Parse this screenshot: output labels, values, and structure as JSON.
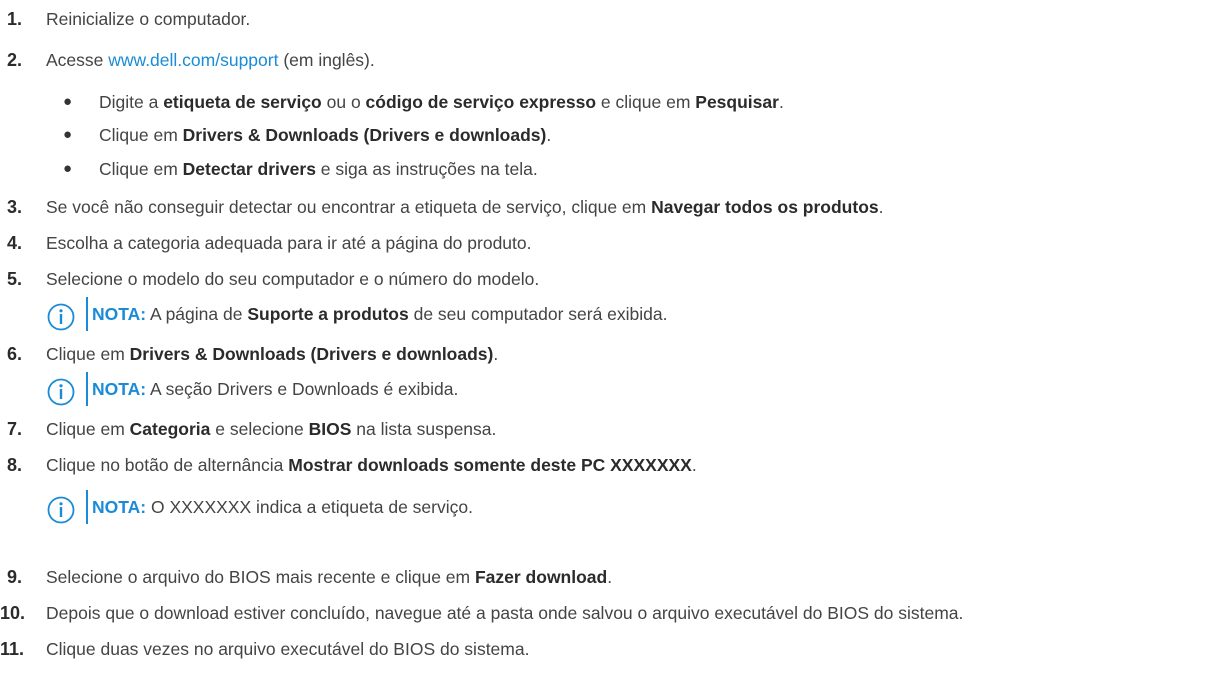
{
  "steps": [
    {
      "n": "1.",
      "parts": [
        {
          "t": "Reinicialize o computador."
        }
      ]
    },
    {
      "n": "2.",
      "parts": [
        {
          "t": "Acesse "
        },
        {
          "t": "www.dell.com/support",
          "link": true
        },
        {
          "t": " (em inglês)."
        }
      ]
    },
    {
      "n": "3.",
      "parts": [
        {
          "t": "Se você não conseguir detectar ou encontrar a etiqueta de serviço, clique em "
        },
        {
          "t": "Navegar todos os produtos",
          "b": true
        },
        {
          "t": "."
        }
      ]
    },
    {
      "n": "4.",
      "parts": [
        {
          "t": "Escolha a categoria adequada para ir até a página do produto."
        }
      ]
    },
    {
      "n": "5.",
      "parts": [
        {
          "t": "Selecione o modelo do seu computador e o número do modelo."
        }
      ]
    },
    {
      "n": "6.",
      "parts": [
        {
          "t": "Clique em "
        },
        {
          "t": "Drivers & Downloads (Drivers e downloads)",
          "b": true
        },
        {
          "t": "."
        }
      ]
    },
    {
      "n": "7.",
      "parts": [
        {
          "t": "Clique em "
        },
        {
          "t": "Categoria",
          "b": true
        },
        {
          "t": " e selecione "
        },
        {
          "t": "BIOS",
          "b": true
        },
        {
          "t": " na lista suspensa."
        }
      ]
    },
    {
      "n": "8.",
      "parts": [
        {
          "t": "Clique no botão de alternância "
        },
        {
          "t": "Mostrar downloads somente deste PC XXXXXXX",
          "b": true
        },
        {
          "t": "."
        }
      ]
    },
    {
      "n": "9.",
      "parts": [
        {
          "t": "Selecione o arquivo do BIOS mais recente e clique em "
        },
        {
          "t": "Fazer download",
          "b": true
        },
        {
          "t": "."
        }
      ]
    },
    {
      "n": "10.",
      "parts": [
        {
          "t": "Depois que o download estiver concluído, navegue até a pasta onde salvou o arquivo executável do BIOS do sistema."
        }
      ]
    },
    {
      "n": "11.",
      "parts": [
        {
          "t": "Clique duas vezes no arquivo executável do BIOS do sistema."
        }
      ]
    }
  ],
  "bullets": [
    {
      "parts": [
        {
          "t": "Digite a "
        },
        {
          "t": "etiqueta de serviço",
          "b": true
        },
        {
          "t": " ou o "
        },
        {
          "t": "código de serviço expresso",
          "b": true
        },
        {
          "t": " e clique em "
        },
        {
          "t": "Pesquisar",
          "b": true
        },
        {
          "t": "."
        }
      ]
    },
    {
      "parts": [
        {
          "t": "Clique em "
        },
        {
          "t": "Drivers & Downloads (Drivers e downloads)",
          "b": true
        },
        {
          "t": "."
        }
      ]
    },
    {
      "parts": [
        {
          "t": "Clique em "
        },
        {
          "t": "Detectar drivers",
          "b": true
        },
        {
          "t": " e siga as instruções na tela."
        }
      ]
    }
  ],
  "bullet_char": "●",
  "notes": [
    {
      "label": "NOTA:",
      "parts": [
        {
          "t": " A página de "
        },
        {
          "t": "Suporte a produtos",
          "b": true
        },
        {
          "t": " de seu computador será exibida."
        }
      ]
    },
    {
      "label": "NOTA:",
      "parts": [
        {
          "t": " A seção Drivers e Downloads é exibida."
        }
      ]
    },
    {
      "label": "NOTA:",
      "parts": [
        {
          "t": " O XXXXXXX indica a etiqueta de serviço."
        }
      ]
    }
  ],
  "colors": {
    "link": "#1a8bd6",
    "text": "#444444",
    "note_icon": "#1a8bd6"
  },
  "note_icon_name": "info-icon"
}
